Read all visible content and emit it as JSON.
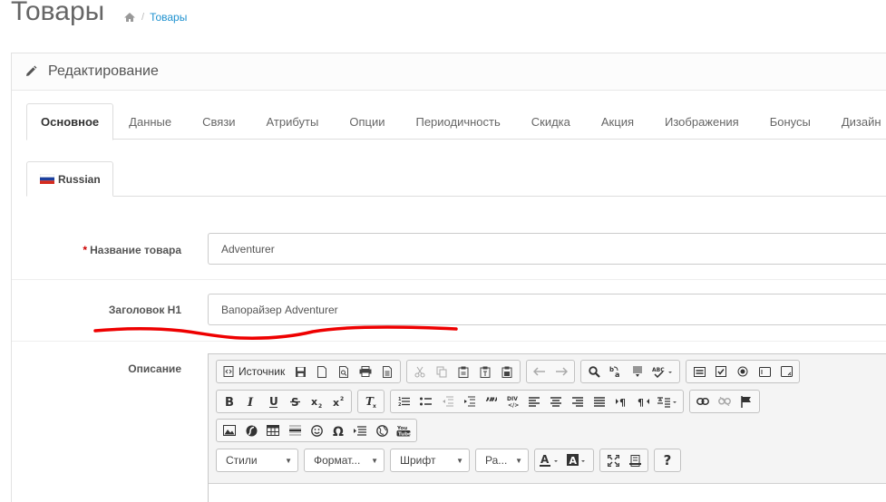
{
  "header": {
    "title": "Товары",
    "breadcrumb": {
      "current": "Товары"
    }
  },
  "panel": {
    "title": "Редактирование"
  },
  "tabs": [
    {
      "label": "Основное",
      "active": true
    },
    {
      "label": "Данные"
    },
    {
      "label": "Связи"
    },
    {
      "label": "Атрибуты"
    },
    {
      "label": "Опции"
    },
    {
      "label": "Периодичность"
    },
    {
      "label": "Скидка"
    },
    {
      "label": "Акция"
    },
    {
      "label": "Изображения"
    },
    {
      "label": "Бонусы"
    },
    {
      "label": "Дизайн"
    }
  ],
  "language_tab": {
    "label": "Russian"
  },
  "form": {
    "name": {
      "required_mark": "*",
      "label": "Название товара",
      "value": "Adventurer"
    },
    "h1": {
      "label": "Заголовок H1",
      "value": "Вапорайзер Adventurer"
    },
    "description": {
      "label": "Описание"
    }
  },
  "editor": {
    "source_label": "Источник",
    "styles_label": "Стили",
    "format_label": "Формат...",
    "font_label": "Шрифт",
    "size_label": "Ра...",
    "help_label": "?"
  },
  "colors": {
    "accent": "#1e91cf",
    "required": "#cc0000",
    "annotation": "#ee0000"
  }
}
